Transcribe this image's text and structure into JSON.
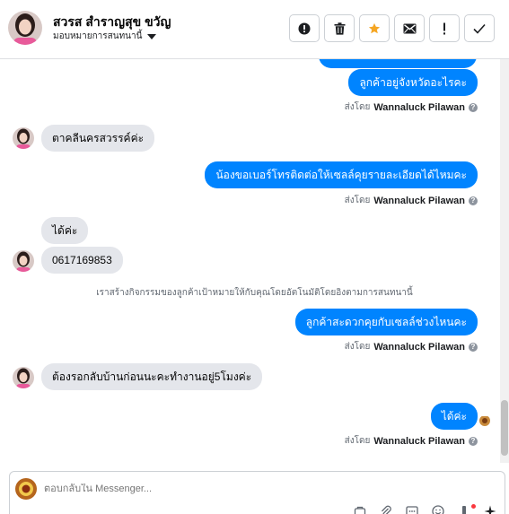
{
  "header": {
    "contact_name": "สวรส สำราญสุข ขวัญ",
    "assign_label": "มอบหมายการสนทนานี้",
    "actions": [
      {
        "name": "report-spam-button",
        "icon": "exclamation-circle-icon"
      },
      {
        "name": "delete-button",
        "icon": "trash-icon"
      },
      {
        "name": "star-button",
        "icon": "star-icon"
      },
      {
        "name": "mark-unread-button",
        "icon": "envelope-icon"
      },
      {
        "name": "follow-up-button",
        "icon": "exclamation-icon"
      },
      {
        "name": "mark-done-button",
        "icon": "check-icon"
      }
    ]
  },
  "messages": {
    "out_1": "ลูกค้าอยู่จังหวัดอะไรคะ",
    "in_1": "ตาคลีนครสวรรค์ค่ะ",
    "out_2": "น้องขอเบอร์โทรติดต่อให้เซลล์คุยรายละเอียดได้ไหมคะ",
    "in_2a": "ได้ค่ะ",
    "in_2b": "0617169853",
    "notice": "เราสร้างกิจกรรมของลูกค้าเป้าหมายให้กับคุณโดยอัตโนมัติโดยอิงตามการสนทนานี้",
    "out_3": "ลูกค้าสะดวกคุยกับเซลล์ช่วงไหนคะ",
    "in_3": "ต้องรอกลับบ้านก่อนนะคะทำงานอยู่5โมงค่ะ",
    "out_4": "ได้ค่ะ"
  },
  "sent_by": {
    "prefix": "ส่งโดย",
    "agent": "Wannaluck Pilawan",
    "help": "?"
  },
  "composer": {
    "placeholder": "ตอบกลับใน Messenger...",
    "tools": [
      "template-icon",
      "attachment-icon",
      "saved-reply-icon",
      "emoji-icon",
      "tag-icon",
      "sparkle-icon"
    ]
  },
  "colors": {
    "outgoing": "#0084ff",
    "incoming": "#e4e6eb",
    "star": "#f5a623"
  }
}
